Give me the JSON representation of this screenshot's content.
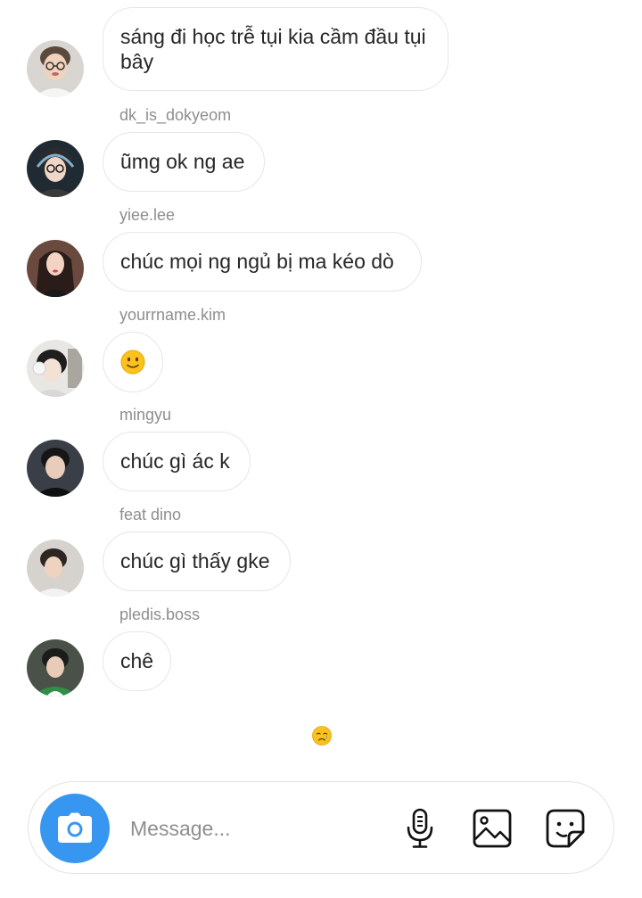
{
  "messages": [
    {
      "sender": "",
      "text": "sáng đi học trễ tụi kia cầm đầu tụi bây",
      "avatar": "avatar-1"
    },
    {
      "sender": "dk_is_dokyeom",
      "text": "ũmg ok ng ae",
      "avatar": "avatar-2"
    },
    {
      "sender": "yiee.lee",
      "text": "chúc mọi ng ngủ bị ma kéo dò",
      "avatar": "avatar-3"
    },
    {
      "sender": "yourrname.kim",
      "text": "",
      "emoji": "slightly-smiling-face-icon",
      "avatar": "avatar-4"
    },
    {
      "sender": "mingyu",
      "text": "chúc gì ác k",
      "avatar": "avatar-5"
    },
    {
      "sender": "feat dino",
      "text": "chúc gì thấy gke",
      "avatar": "avatar-6"
    },
    {
      "sender": "pledis.boss",
      "text": "chê",
      "avatar": "avatar-7"
    }
  ],
  "reaction": {
    "icon": "crying-face-icon"
  },
  "composer": {
    "placeholder": "Message...",
    "value": "",
    "camera_icon": "camera-icon",
    "mic_icon": "microphone-icon",
    "gallery_icon": "image-icon",
    "sticker_icon": "sticker-icon",
    "accent_color": "#3797f0"
  }
}
